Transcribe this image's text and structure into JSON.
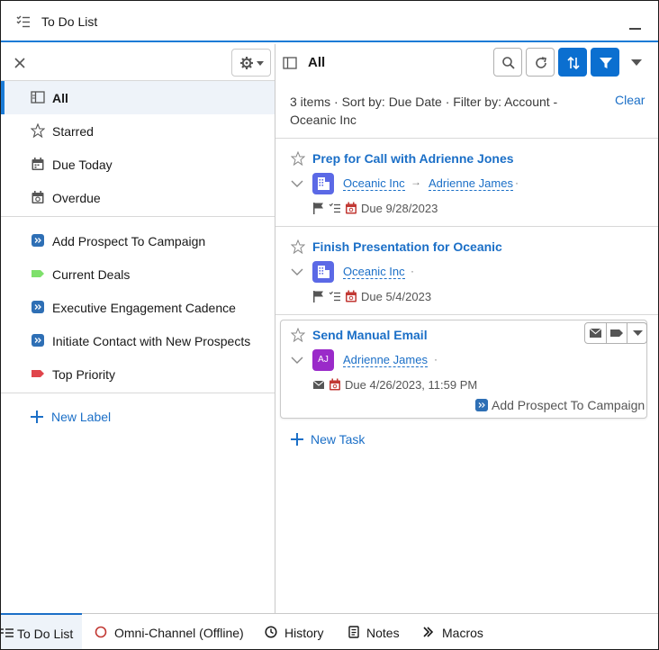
{
  "window": {
    "title": "To Do List"
  },
  "left": {
    "items": [
      {
        "label": "All",
        "active": true
      },
      {
        "label": "Starred"
      },
      {
        "label": "Due Today"
      },
      {
        "label": "Overdue"
      }
    ],
    "labels": [
      {
        "label": "Add Prospect To Campaign",
        "color": "#2e6fb5"
      },
      {
        "label": "Current Deals",
        "color": "#7ee06b"
      },
      {
        "label": "Executive Engagement Cadence",
        "color": "#2e6fb5"
      },
      {
        "label": "Initiate Contact with New Prospects",
        "color": "#2e6fb5"
      },
      {
        "label": "Top Priority",
        "color": "#e0454b"
      }
    ],
    "new_label": "New Label"
  },
  "right": {
    "title": "All",
    "summary": "3 items · Sort by: Due Date · Filter by: Account - Oceanic Inc",
    "clear": "Clear",
    "tasks": [
      {
        "title": "Prep for Call with Adrienne Jones",
        "account": "Oceanic Inc",
        "contact": "Adrienne James",
        "due": "Due 9/28/2023"
      },
      {
        "title": "Finish Presentation for Oceanic",
        "account": "Oceanic Inc",
        "due": "Due 5/4/2023"
      },
      {
        "title": "Send Manual Email",
        "contact_initials": "AJ",
        "contact": "Adrienne James",
        "due": "Due 4/26/2023, 11:59 PM",
        "tag": "Add Prospect To Campaign"
      }
    ],
    "new_task": "New Task"
  },
  "bottom_tabs": [
    {
      "label": "To Do List",
      "active": true
    },
    {
      "label": "Omni-Channel (Offline)"
    },
    {
      "label": "History"
    },
    {
      "label": "Notes"
    },
    {
      "label": "Macros"
    }
  ],
  "colors": {
    "accent": "#1b7bd6",
    "link": "#1b6fc7",
    "account_icon": "#5b69e6",
    "contact_icon": "#9a2ac9",
    "due_icon": "#c23934"
  }
}
